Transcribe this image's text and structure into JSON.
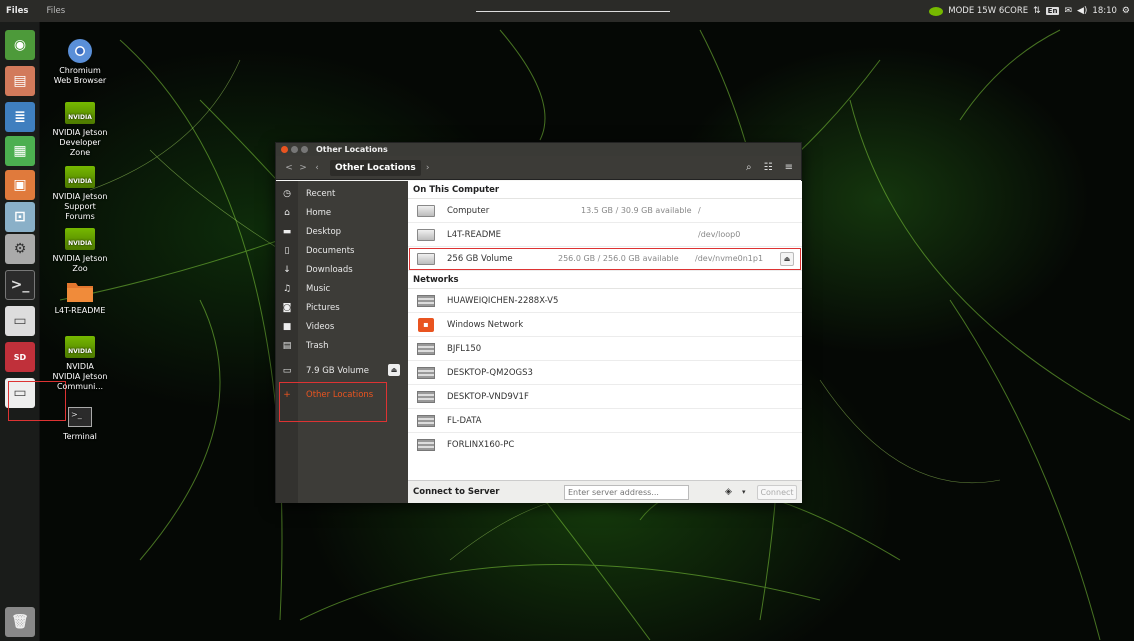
{
  "topbar": {
    "app_name": "Files",
    "menu": "Files",
    "mode": "MODE 15W 6CORE",
    "lang": "En",
    "time": "18:10"
  },
  "desktop_icons": [
    {
      "label": "Chromium Web Browser",
      "icon": "chromium-icon"
    },
    {
      "label": "NVIDIA Jetson Developer Zone",
      "badge": "NVIDIA",
      "icon": "nvidia-icon"
    },
    {
      "label": "NVIDIA Jetson Support Forums",
      "badge": "NVIDIA",
      "icon": "nvidia-icon"
    },
    {
      "label": "NVIDIA Jetson Zoo",
      "badge": "NVIDIA",
      "icon": "nvidia-icon"
    },
    {
      "label": "L4T-README",
      "icon": "folder-icon"
    },
    {
      "label": "NVIDIA NVIDIA Jetson Communi...",
      "badge": "NVIDIA",
      "icon": "nvidia-icon"
    },
    {
      "label": "Terminal",
      "icon": "terminal-icon"
    }
  ],
  "window": {
    "title": "Other Locations",
    "breadcrumb": "Other Locations",
    "sidebar": [
      {
        "label": "Recent",
        "icon": "clock-icon"
      },
      {
        "label": "Home",
        "icon": "home-icon"
      },
      {
        "label": "Desktop",
        "icon": "desktop-icon"
      },
      {
        "label": "Documents",
        "icon": "document-icon"
      },
      {
        "label": "Downloads",
        "icon": "download-icon"
      },
      {
        "label": "Music",
        "icon": "music-icon"
      },
      {
        "label": "Pictures",
        "icon": "camera-icon"
      },
      {
        "label": "Videos",
        "icon": "video-icon"
      },
      {
        "label": "Trash",
        "icon": "trash-icon"
      },
      {
        "label": "7.9 GB Volume",
        "icon": "drive-icon"
      },
      {
        "label": "Other Locations",
        "icon": "plus-icon"
      }
    ],
    "on_this_computer_header": "On This Computer",
    "devices": [
      {
        "name": "Computer",
        "size": "13.5 GB / 30.9 GB available",
        "path": "/"
      },
      {
        "name": "L4T-README",
        "size": "",
        "path": "/dev/loop0"
      },
      {
        "name": "256 GB Volume",
        "size": "256.0 GB / 256.0 GB available",
        "path": "/dev/nvme0n1p1"
      }
    ],
    "networks_header": "Networks",
    "networks": [
      "HUAWEIQICHEN-2288X-V5",
      "Windows Network",
      "BJFL150",
      "DESKTOP-QM2OGS3",
      "DESKTOP-VND9V1F",
      "FL-DATA",
      "FORLINX160-PC"
    ],
    "connect_label": "Connect to Server",
    "server_placeholder": "Enter server address...",
    "connect_button": "Connect"
  }
}
